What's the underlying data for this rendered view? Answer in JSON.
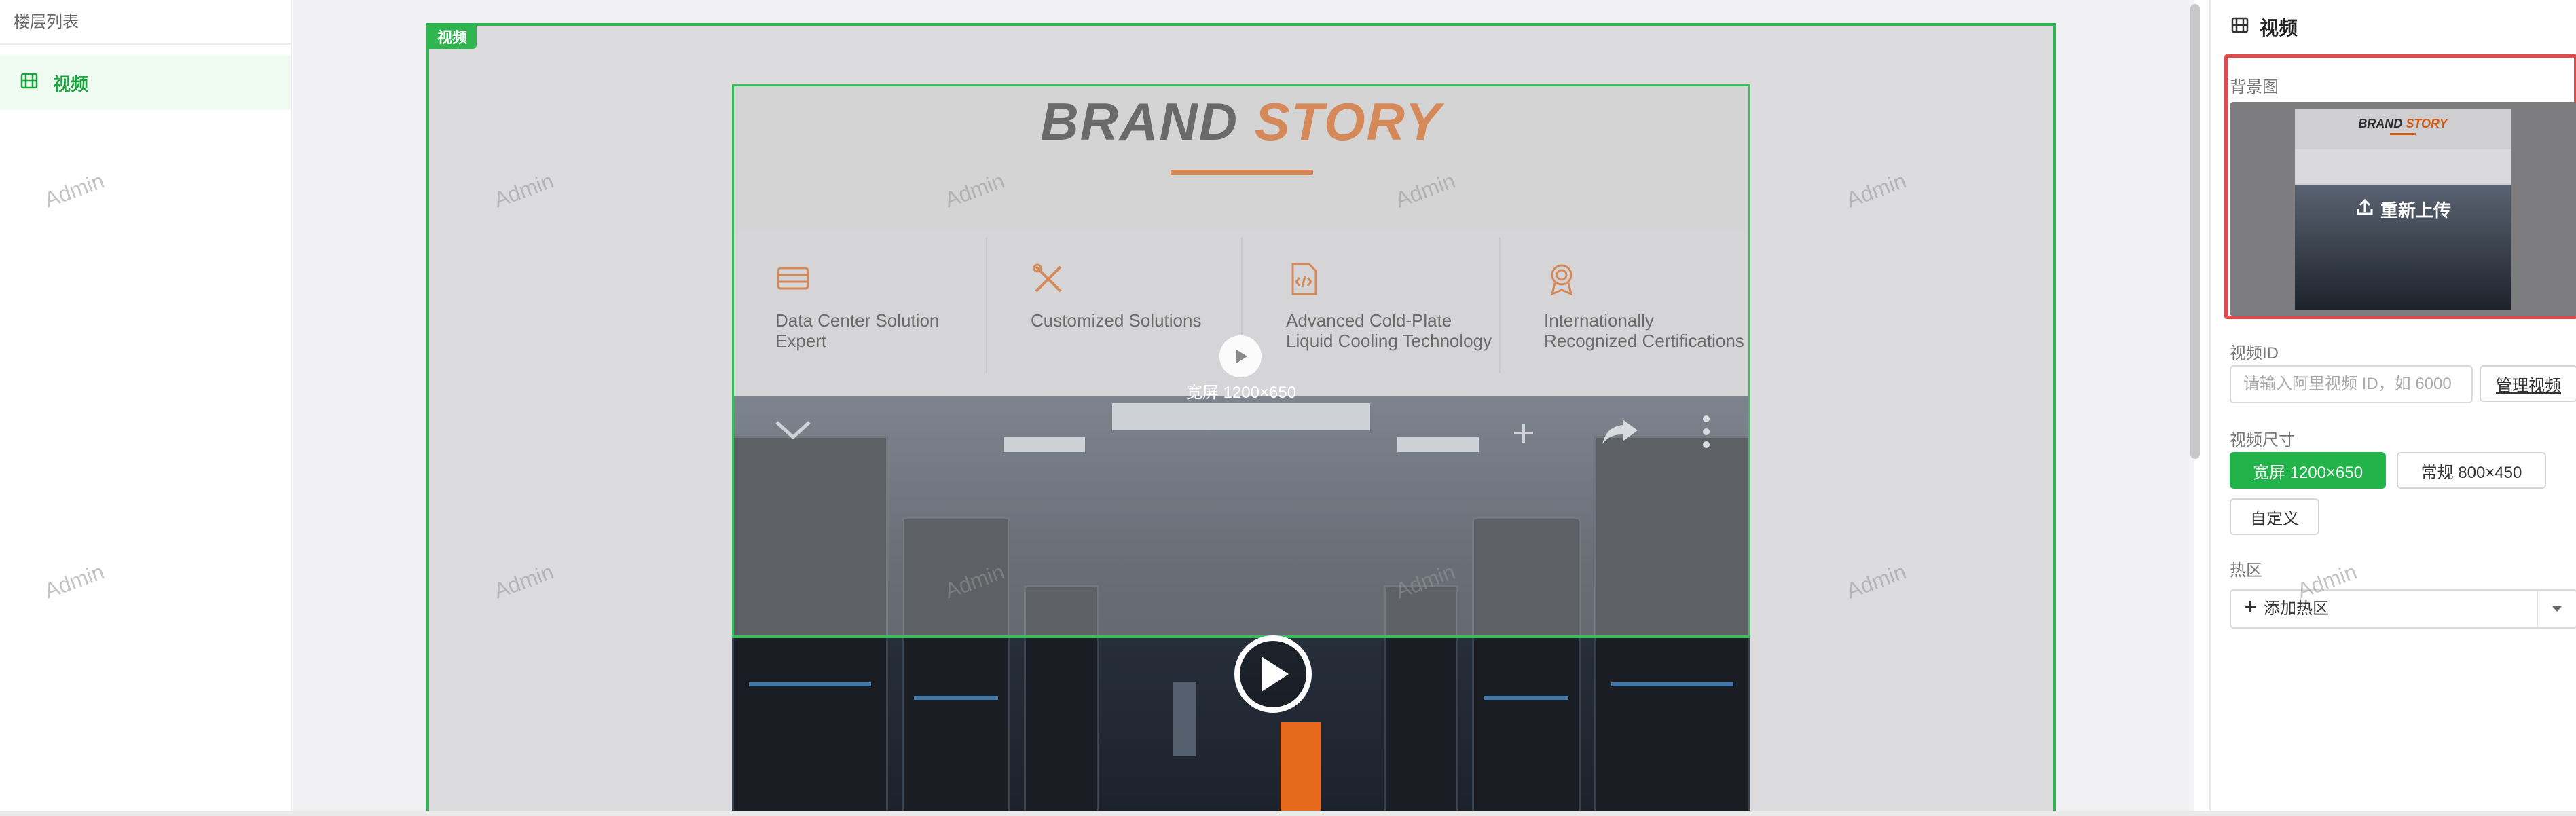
{
  "layer_panel": {
    "title": "楼层列表",
    "items": [
      {
        "label": "视频",
        "active": true
      }
    ]
  },
  "canvas": {
    "module_tag": "视频",
    "watermark": "Admin",
    "brand": {
      "word1": "BRAND",
      "word2": "STORY"
    },
    "features": [
      {
        "icon": "server-icon",
        "text": "Data Center Solution Expert"
      },
      {
        "icon": "tools-icon",
        "text": "Customized Solutions"
      },
      {
        "icon": "code-file-icon",
        "text": "Advanced Cold-Plate Liquid Cooling Technology"
      },
      {
        "icon": "award-icon",
        "text": "Internationally Recognized Certifications"
      }
    ],
    "size_badge": "宽屏 1200×650"
  },
  "prop_panel": {
    "title": "视频",
    "background_label": "背景图",
    "reupload_label": "重新上传",
    "video_id_label": "视频ID",
    "video_id_placeholder": "请输入阿里视频 ID，如 6000",
    "manage_video_label": "管理视频",
    "video_size_label": "视频尺寸",
    "size_options": [
      {
        "label": "宽屏 1200×650",
        "selected": true
      },
      {
        "label": "常规 800×450",
        "selected": false
      },
      {
        "label": "自定义",
        "selected": false
      }
    ],
    "hotspot_label": "热区",
    "add_hotspot_label": "添加热区"
  },
  "colors": {
    "accent_green": "#22b34b",
    "brand_orange": "#d35c12",
    "highlight_red": "#e3484b"
  }
}
